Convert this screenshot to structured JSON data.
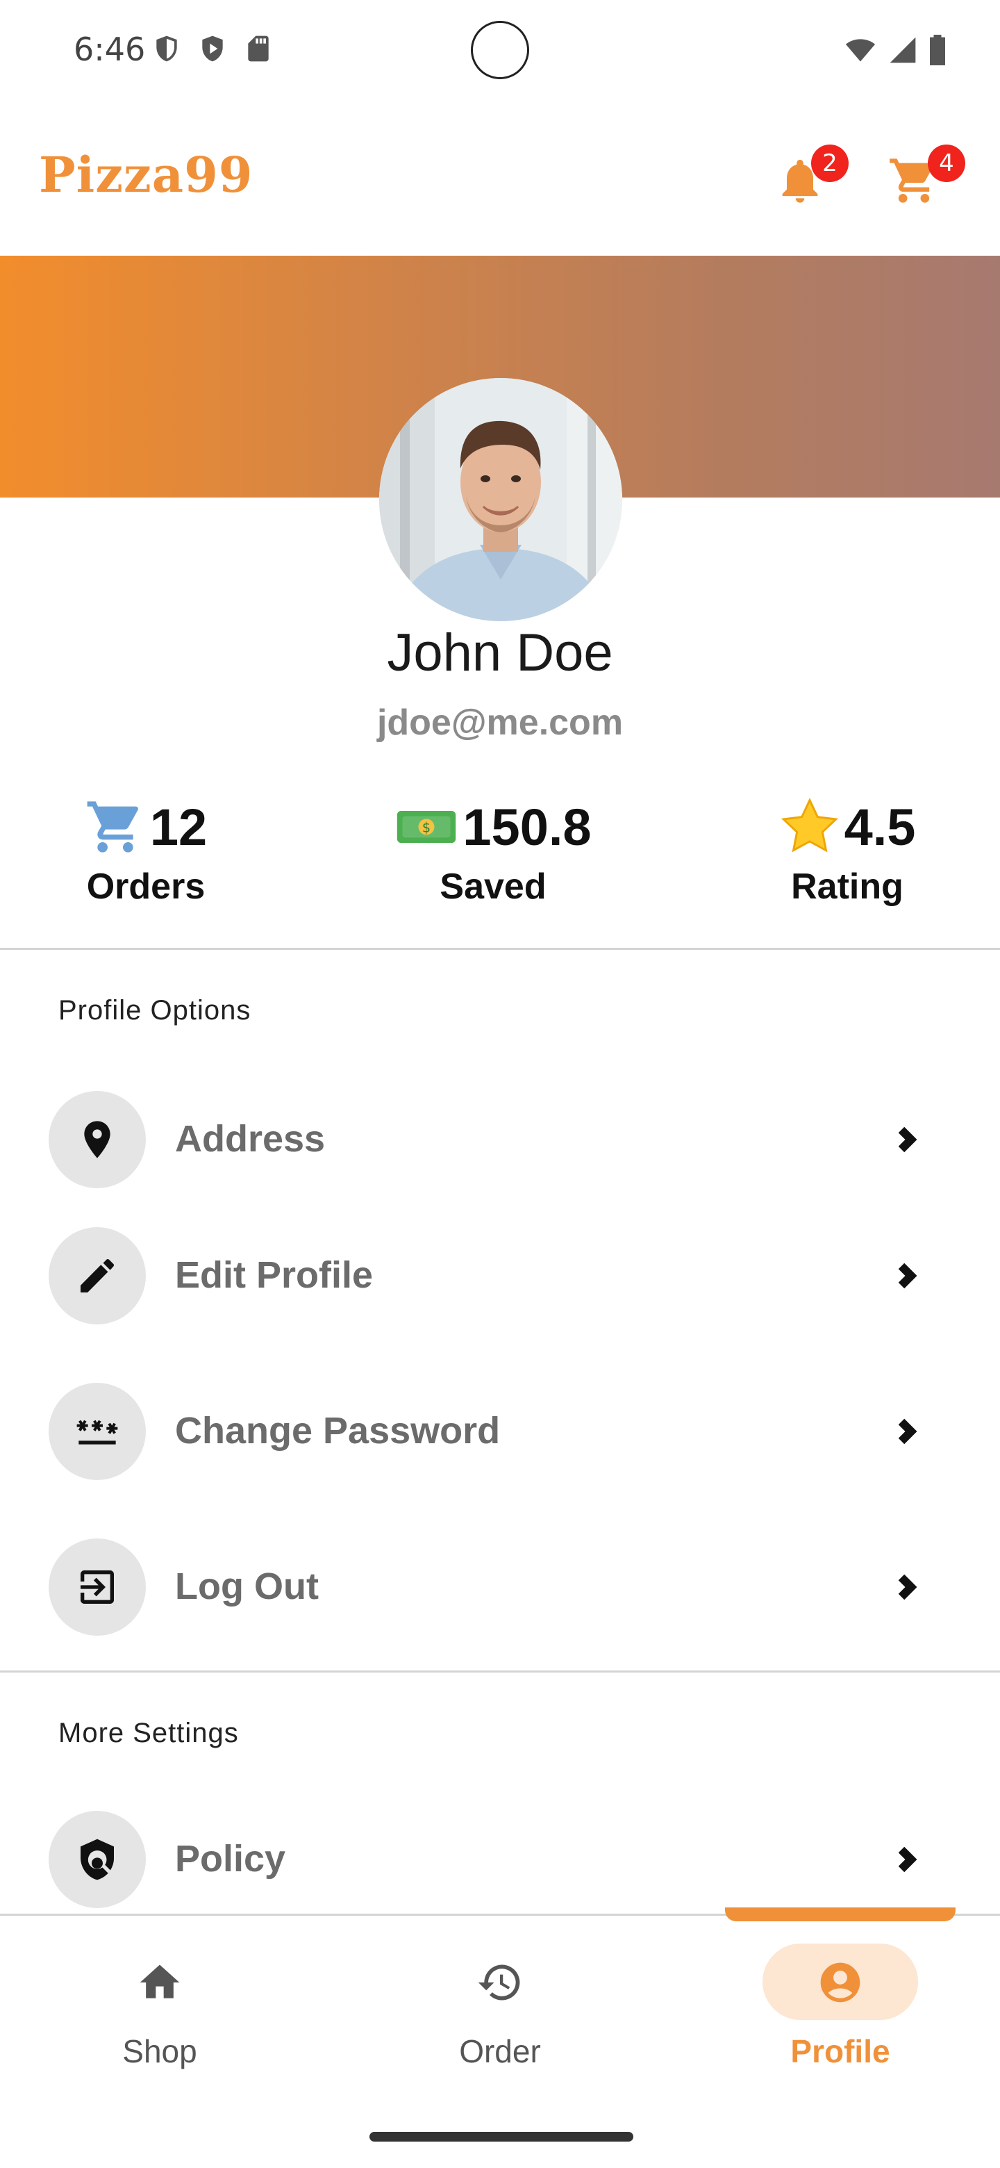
{
  "status_bar": {
    "time": "6:46"
  },
  "header": {
    "brand": "Pizza99",
    "notifications_badge": "2",
    "cart_badge": "4",
    "accent_color": "#f0913a"
  },
  "profile": {
    "name": "John Doe",
    "email": "jdoe@me.com"
  },
  "stats": {
    "orders": {
      "emoji": "🛒",
      "value": "12",
      "label": "Orders"
    },
    "saved": {
      "emoji": "💵",
      "value": "150.8",
      "label": "Saved"
    },
    "rating": {
      "emoji": "⭐",
      "value": "4.5",
      "label": "Rating"
    }
  },
  "sections": {
    "profile_options": {
      "title": "Profile Options",
      "items": [
        {
          "label": "Address",
          "icon": "location-pin-icon"
        },
        {
          "label": "Edit Profile",
          "icon": "pencil-icon"
        },
        {
          "label": "Change Password",
          "icon": "password-icon"
        },
        {
          "label": "Log Out",
          "icon": "logout-icon"
        }
      ]
    },
    "more_settings": {
      "title": "More Settings",
      "items": [
        {
          "label": "Policy",
          "icon": "policy-shield-icon"
        }
      ]
    }
  },
  "bottom_nav": {
    "items": [
      {
        "label": "Shop",
        "icon": "home-icon",
        "active": false
      },
      {
        "label": "Order",
        "icon": "history-icon",
        "active": false
      },
      {
        "label": "Profile",
        "icon": "account-circle-icon",
        "active": true
      }
    ]
  }
}
